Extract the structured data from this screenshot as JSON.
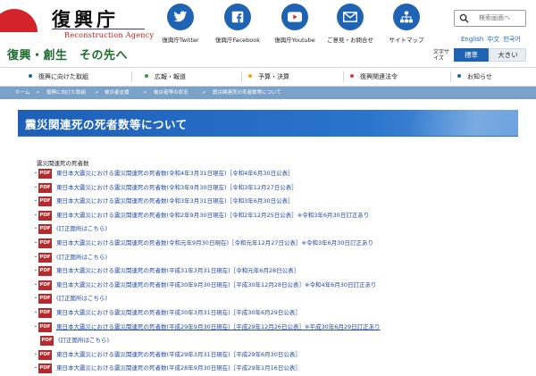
{
  "header": {
    "logo_title": "復興庁",
    "logo_sub": "Reconstruction Agency",
    "slogan": "復興・創生　その先へ",
    "social": [
      {
        "label": "復興庁Twitter",
        "icon": "twitter-icon"
      },
      {
        "label": "復興庁Facebook",
        "icon": "facebook-icon"
      },
      {
        "label": "復興庁Youtube",
        "icon": "youtube-icon"
      },
      {
        "label": "ご意見・お問合せ",
        "icon": "mail-icon"
      },
      {
        "label": "サイトマップ",
        "icon": "sitemap-icon"
      }
    ],
    "search_placeholder": "検索画面へ",
    "languages": [
      "English",
      "中文",
      "한국어"
    ],
    "text_size_label": "文字サイズ",
    "size_standard": "標準",
    "size_large": "大きい"
  },
  "colors": {
    "brand_blue": "#1f63b4",
    "brand_red": "#c4161c",
    "slogan_green": "#1e6d2d",
    "link_blue": "#1f49a8",
    "pdf_red": "#b52a2a"
  },
  "nav": [
    {
      "label": "復興に向けた取組",
      "dot": "#1f63b4"
    },
    {
      "label": "広報・報道",
      "dot": "#2f9a3a"
    },
    {
      "label": "予算・決算",
      "dot": "#e0a800"
    },
    {
      "label": "復興関連法令",
      "dot": "#d23b3b"
    },
    {
      "label": "お知らせ",
      "dot": "#1f63b4"
    }
  ],
  "breadcrumb": [
    "ホーム",
    "復興に向けた取組",
    "被災者支援",
    "被災者等の状況",
    "震災関連死の死者数等について"
  ],
  "page_title": "震災関連死の死者数等について",
  "section_head": "震災関連死の死者数",
  "pdf_label": "PDF",
  "items": [
    {
      "text": "東日本大震災における震災関連死の死者数(令和4年3月31日現在)［令和4年6月30日公表］"
    },
    {
      "text": "東日本大震災における震災関連死の死者数(令和3年9月30日現在)［令和3年12月27日公表］"
    },
    {
      "text": "東日本大震災における震災関連死の死者数(令和3年3月31日現在)［令和3年6月30日公表］"
    },
    {
      "text": "東日本大震災における震災関連死の死者数(令和2年9月30日現在)［令和2年12月25日公表］※令和3年6月30日訂正あり"
    },
    {
      "text": "(訂正箇所はこちら)"
    },
    {
      "text": "東日本大震災における震災関連死の死者数(令和元年9月30日現在)［令和元年12月27日公表］※令和3年6月30日訂正あり"
    },
    {
      "text": "(訂正箇所はこちら)"
    },
    {
      "text": "東日本大震災における震災関連死の死者数(平成31年3月31日現在)［令和元年6月28日公表］"
    },
    {
      "text": "東日本大震災における震災関連死の死者数(平成30年9月30日現在)［平成30年12月28日公表］※令和4年6月30日訂正あり"
    },
    {
      "text": "(訂正箇所はこちら)"
    },
    {
      "text": "東日本大震災における震災関連死の死者数(平成30年3月31日現在)［平成30年6月29日公表］"
    },
    {
      "text": "東日本大震災における震災関連死の死者数(平成29年9月30日現在)［平成29年12月26日公表］※平成30年6月29日訂正あり"
    },
    {
      "text": "(訂正箇所はこちら)"
    },
    {
      "text": "東日本大震災における震災関連死の死者数(平成29年3月31日現在)［平成29年6月30日公表］"
    },
    {
      "text": "東日本大震災における震災関連死の死者数(平成28年9月30日現在)［平成29年1月16日公表］"
    }
  ]
}
